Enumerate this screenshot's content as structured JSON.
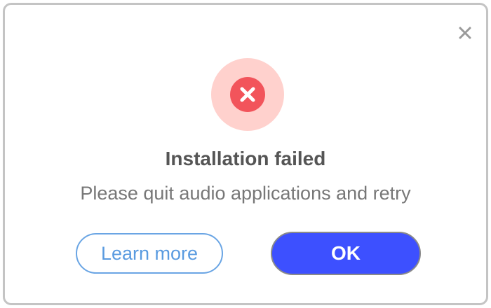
{
  "dialog": {
    "close_icon": "close-icon",
    "status_icon": "error-circle-x-icon",
    "title": "Installation failed",
    "message": "Please quit audio applications and retry",
    "learn_more_label": "Learn more",
    "ok_label": "OK"
  },
  "colors": {
    "status_ring": "#ffd1cd",
    "status_fill": "#f2545b",
    "primary_button": "#3d50ff",
    "secondary_button_border": "#6aa5e4",
    "secondary_button_text": "#5a9be0",
    "title_text": "#555555",
    "message_text": "#777777"
  }
}
